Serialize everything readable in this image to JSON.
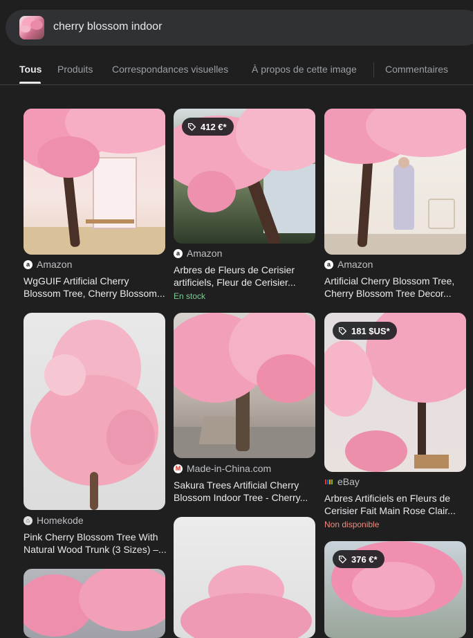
{
  "search": {
    "query": "cherry blossom indoor"
  },
  "tabs": [
    {
      "label": "Tous"
    },
    {
      "label": "Produits"
    },
    {
      "label": "Correspondances visuelles"
    },
    {
      "label": "À propos de cette image"
    },
    {
      "label": "Commentaires"
    }
  ],
  "results": [
    {
      "source": "Amazon",
      "title_line1": "WgGUIF Artificial Cherry",
      "title_line2": "Blossom Tree, Cherry Blossom..."
    },
    {
      "price": "412 €*",
      "source": "Amazon",
      "title_line1": "Arbres de Fleurs de Cerisier",
      "title_line2": "artificiels, Fleur de Cerisier...",
      "status": "En stock"
    },
    {
      "source": "Amazon",
      "title_line1": "Artificial Cherry Blossom Tree,",
      "title_line2": "Cherry Blossom Tree Decor..."
    },
    {
      "source": "Homekode",
      "title_line1": "Pink Cherry Blossom Tree With",
      "title_line2": "Natural Wood Trunk (3 Sizes) –..."
    },
    {
      "source": "Made-in-China.com",
      "title_line1": "Sakura Trees Artificial Cherry",
      "title_line2": "Blossom Indoor Tree - Cherry..."
    },
    {
      "price": "181 $US*",
      "source": "eBay",
      "title_line1": "Arbres Artificiels en Fleurs de",
      "title_line2": "Cerisier Fait Main Rose Clair...",
      "status": "Non disponible"
    },
    {
      "price": "376 €*"
    }
  ],
  "colors": {
    "in_stock": "#81c995",
    "unavailable": "#f28b82",
    "background": "#1f1f1f"
  }
}
